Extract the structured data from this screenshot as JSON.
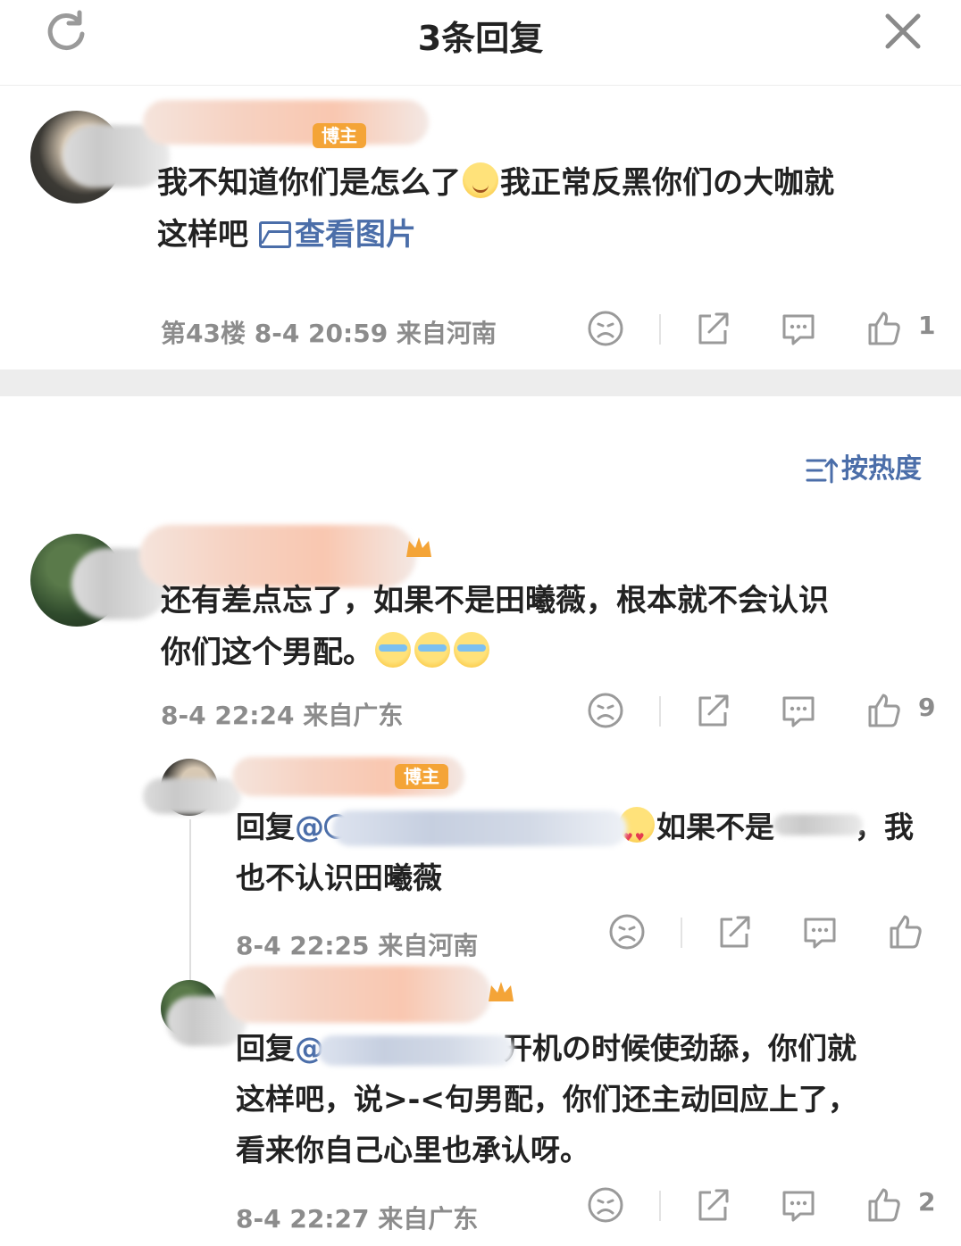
{
  "header": {
    "title": "3条回复",
    "refresh_icon": "refresh-icon",
    "close_icon": "close-icon"
  },
  "main_comment": {
    "badge": "博主",
    "text_part1": "我不知道你们是怎么了",
    "text_part2": "我正常反黑你们の大咖就",
    "text_part3": "这样吧",
    "view_image": "查看图片",
    "meta": "第43楼  8-4 20:59  来自河南",
    "like_count": "1"
  },
  "sort": {
    "label": "按热度"
  },
  "comments": [
    {
      "text_line1": "还有差点忘了，如果不是田曦薇，根本就不会认识",
      "text_line2": "你们这个男配。",
      "meta": "8-4 22:24  来自广东",
      "like_count": "9"
    }
  ],
  "replies": [
    {
      "badge": "博主",
      "reply_prefix": "回复",
      "text_tail": "如果不是",
      "text_tail2": "，我",
      "text_line2": "也不认识田曦薇",
      "meta": "8-4 22:25  来自河南",
      "like_count": ""
    },
    {
      "reply_prefix": "回复",
      "text_tail": "开机の时候使劲舔，你们就",
      "text_line2": "这样吧，说>-<句男配，你们还主动回应上了，",
      "text_line3": "看来你自己心里也承认呀。",
      "meta": "8-4 22:27  来自广东",
      "like_count": "2"
    }
  ],
  "colors": {
    "link": "#4b6ea9",
    "meta": "#8c8c8c",
    "badge": "#f4a437",
    "separator": "#ededed"
  }
}
